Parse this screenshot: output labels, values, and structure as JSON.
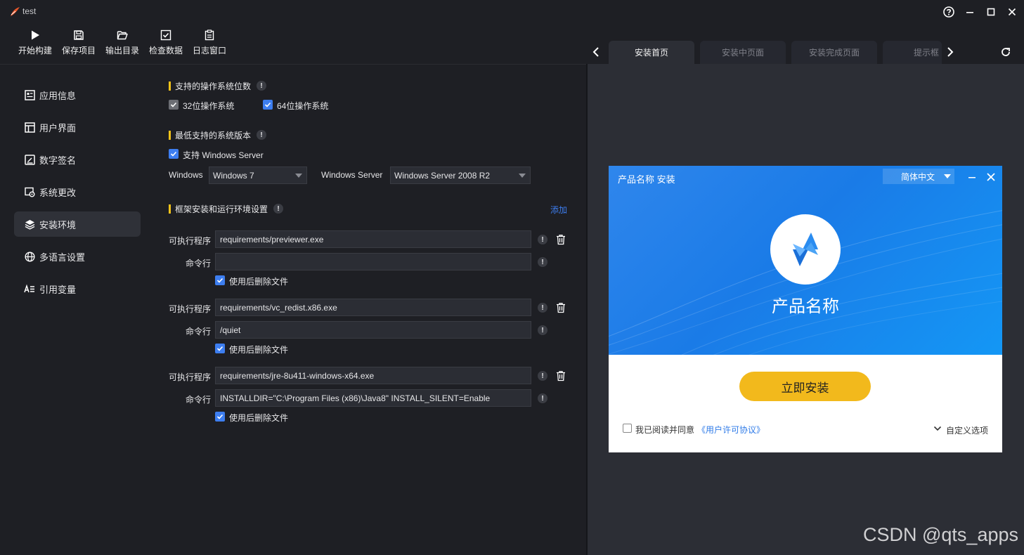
{
  "window": {
    "title": "test"
  },
  "toolbar": [
    {
      "label": "开始构建",
      "icon": "play-icon"
    },
    {
      "label": "保存项目",
      "icon": "save-icon"
    },
    {
      "label": "输出目录",
      "icon": "folder-open-icon"
    },
    {
      "label": "检查数据",
      "icon": "check-square-icon"
    },
    {
      "label": "日志窗口",
      "icon": "clipboard-icon"
    }
  ],
  "tabs": [
    {
      "label": "安装首页",
      "active": true
    },
    {
      "label": "安装中页面"
    },
    {
      "label": "安装完成页面"
    },
    {
      "label": "提示框"
    }
  ],
  "sidebar": [
    {
      "label": "应用信息",
      "icon": "app-info-icon"
    },
    {
      "label": "用户界面",
      "icon": "layout-icon"
    },
    {
      "label": "数字签名",
      "icon": "signature-icon"
    },
    {
      "label": "系统更改",
      "icon": "system-change-icon"
    },
    {
      "label": "安装环境",
      "icon": "layers-icon",
      "active": true
    },
    {
      "label": "多语言设置",
      "icon": "globe-icon"
    },
    {
      "label": "引用变量",
      "icon": "variable-icon"
    }
  ],
  "os_bits": {
    "title": "支持的操作系统位数",
    "opt32": "32位操作系统",
    "opt64": "64位操作系统"
  },
  "min_version": {
    "title": "最低支持的系统版本",
    "support_server": "支持 Windows Server",
    "windows_label": "Windows",
    "windows_value": "Windows 7",
    "server_label": "Windows Server",
    "server_value": "Windows Server 2008 R2"
  },
  "runtime": {
    "title": "框架安装和运行环境设置",
    "add_label": "添加",
    "exe_label": "可执行程序",
    "cmd_label": "命令行",
    "delete_label": "使用后删除文件",
    "items": [
      {
        "exe": "requirements/previewer.exe",
        "cmd": ""
      },
      {
        "exe": "requirements/vc_redist.x86.exe",
        "cmd": "/quiet"
      },
      {
        "exe": "requirements/jre-8u411-windows-x64.exe",
        "cmd": "INSTALLDIR=\"C:\\Program Files (x86)\\Java8\" INSTALL_SILENT=Enable"
      }
    ]
  },
  "installer": {
    "title": "产品名称 安装",
    "language": "简体中文",
    "product_name": "产品名称",
    "install_button": "立即安装",
    "agree_text": "我已阅读并同意",
    "license_link": "《用户许可协议》",
    "custom_options": "自定义选项"
  },
  "watermark": "CSDN @qts_apps",
  "colors": {
    "accent": "#3d7ef0",
    "section_bar": "#f4c319",
    "install_button": "#f2b91c",
    "banner": "#1a7be7"
  }
}
